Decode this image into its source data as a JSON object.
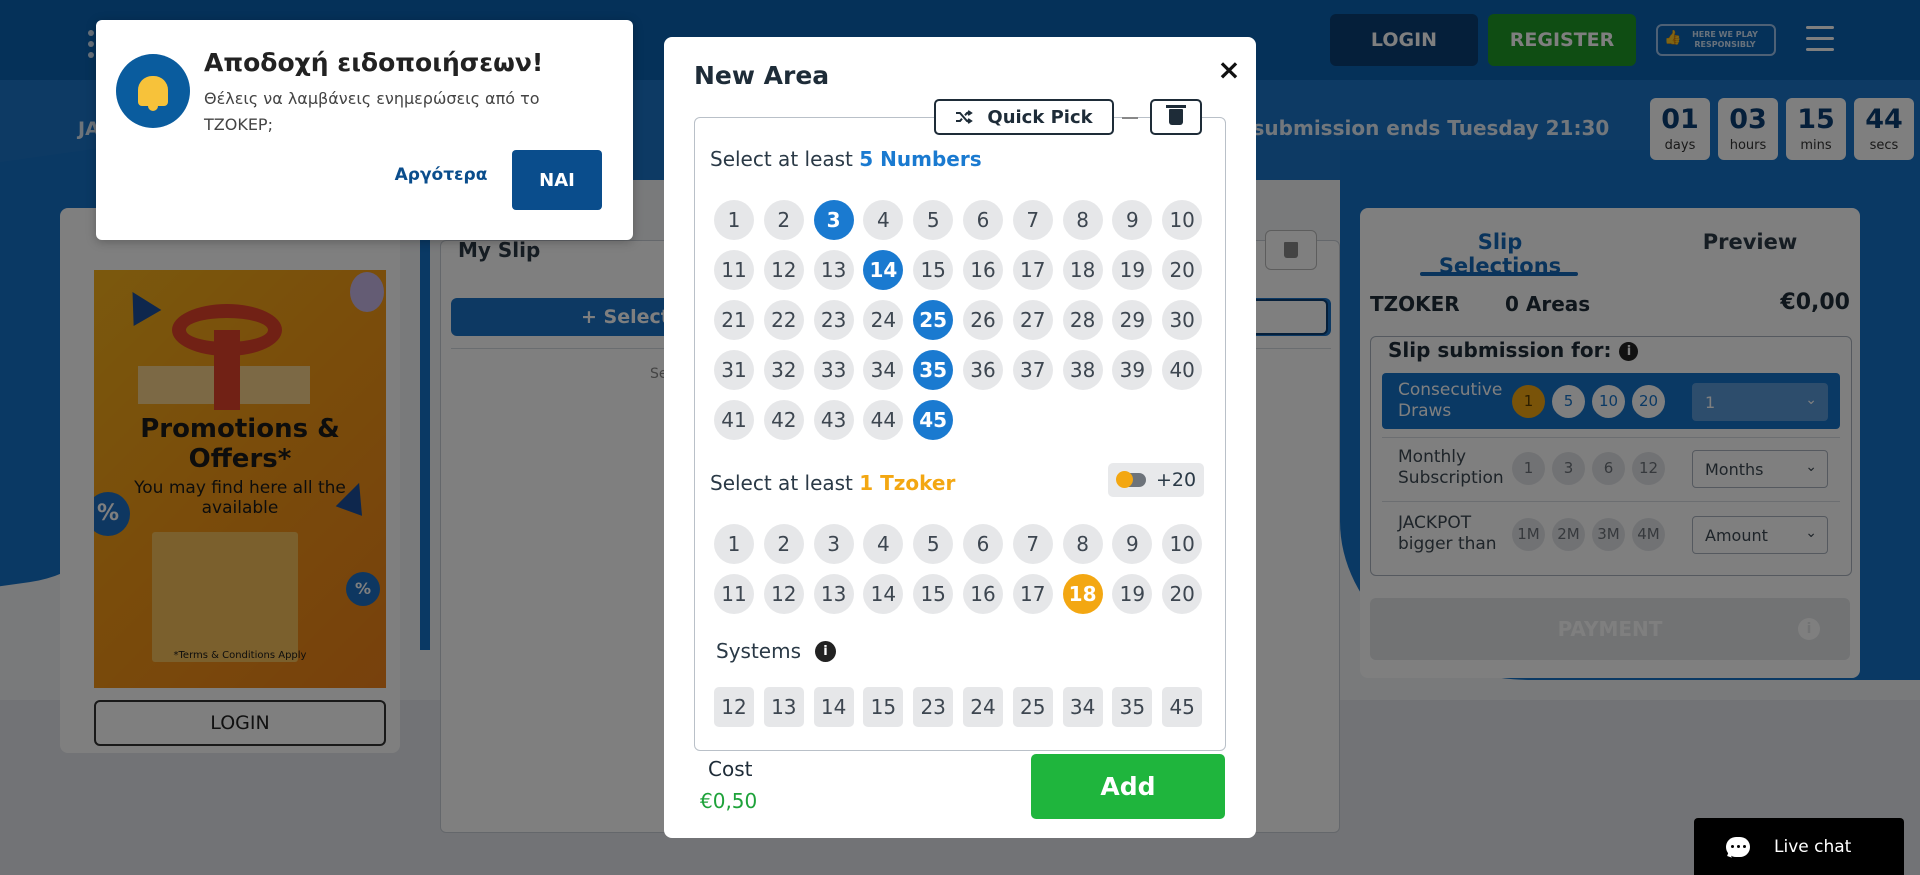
{
  "header": {
    "login_label": "LOGIN",
    "register_label": "REGISTER",
    "responsibly_label": "HERE WE PLAY RESPONSIBLY"
  },
  "banner": {
    "left_text": "JA",
    "submission_text": "t submission ends Tuesday 21:30",
    "countdown": [
      {
        "value": "01",
        "unit": "days"
      },
      {
        "value": "03",
        "unit": "hours"
      },
      {
        "value": "15",
        "unit": "mins"
      },
      {
        "value": "44",
        "unit": "secs"
      }
    ]
  },
  "promo": {
    "title": "Promotions & Offers*",
    "subtitle": "You may find here all the available",
    "terms": "*Terms & Conditions Apply",
    "login_label": "LOGIN"
  },
  "my_slip": {
    "title": "My Slip",
    "select_label": "+ Select",
    "hint_text": "Se"
  },
  "right_panel": {
    "tab_selections": "Slip Selections",
    "tab_preview": "Preview",
    "game": "TZOKER",
    "areas": "0 Areas",
    "amount": "€0,00",
    "submission_title": "Slip submission for:",
    "rows": [
      {
        "label": "Consecutive Draws",
        "options": [
          "1",
          "5",
          "10",
          "20"
        ],
        "selected_option": "1",
        "select_value": "1",
        "active": true
      },
      {
        "label": "Monthly Subscription",
        "options": [
          "1",
          "3",
          "6",
          "12"
        ],
        "select_value": "Months",
        "active": false
      },
      {
        "label": "JACKPOT bigger than",
        "options": [
          "1M",
          "2M",
          "3M",
          "4M"
        ],
        "select_value": "Amount",
        "active": false
      }
    ],
    "payment_label": "PAYMENT"
  },
  "notification": {
    "title": "Αποδοχή ειδοποιήσεων!",
    "message": "Θέλεις να λαμβάνεις ενημερώσεις από το ΤΖΟΚΕΡ;",
    "later_label": "Αργότερα",
    "yes_label": "ΝΑΙ"
  },
  "modal": {
    "title": "New Area",
    "close_symbol": "×",
    "quick_pick_label": "Quick Pick",
    "numbers_prefix": "Select at least ",
    "numbers_highlight": "5 Numbers",
    "numbers_selected": [
      3,
      14,
      25,
      35,
      45
    ],
    "numbers_total": 45,
    "tzoker_prefix": "Select at least ",
    "tzoker_highlight": "1 Tzoker",
    "tzoker_selected": [
      18
    ],
    "tzoker_total": 20,
    "toggle_label": "+20",
    "systems_label": "Systems",
    "systems": [
      "12",
      "13",
      "14",
      "15",
      "23",
      "24",
      "25",
      "34",
      "35",
      "45"
    ],
    "cost_label": "Cost",
    "cost_value": "€0,50",
    "add_label": "Add"
  },
  "live_chat": {
    "label": "Live chat"
  },
  "colors": {
    "primary_blue": "#1a7ad0",
    "dark_blue": "#0a3e74",
    "green": "#1fb53d",
    "orange": "#f3a712"
  }
}
